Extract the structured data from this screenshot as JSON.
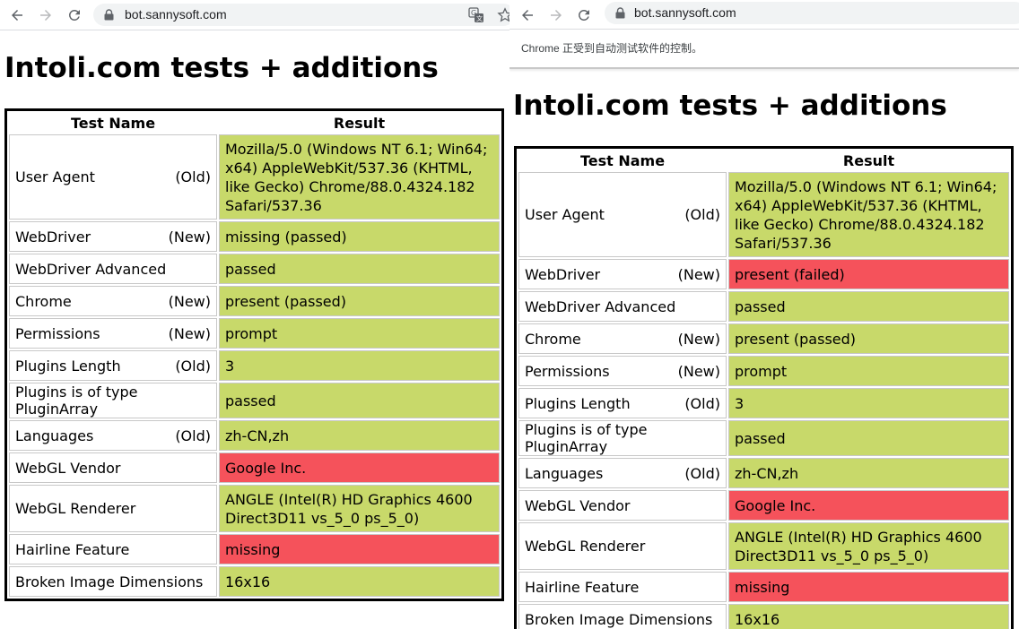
{
  "left": {
    "url": "bot.sannysoft.com",
    "heading": "Intoli.com tests + additions",
    "table": {
      "headers": [
        "Test Name",
        "Result"
      ],
      "rows": [
        {
          "name": "User Agent",
          "tag": "(Old)",
          "result": "Mozilla/5.0 (Windows NT 6.1; Win64; x64) AppleWebKit/537.36 (KHTML, like Gecko) Chrome/88.0.4324.182 Safari/537.36",
          "status": "passed"
        },
        {
          "name": "WebDriver",
          "tag": "(New)",
          "result": "missing (passed)",
          "status": "passed"
        },
        {
          "name": "WebDriver Advanced",
          "tag": "",
          "result": "passed",
          "status": "passed"
        },
        {
          "name": "Chrome",
          "tag": "(New)",
          "result": "present (passed)",
          "status": "passed"
        },
        {
          "name": "Permissions",
          "tag": "(New)",
          "result": "prompt",
          "status": "passed"
        },
        {
          "name": "Plugins Length",
          "tag": "(Old)",
          "result": "3",
          "status": "passed"
        },
        {
          "name": "Plugins is of type PluginArray",
          "tag": "",
          "result": "passed",
          "status": "passed"
        },
        {
          "name": "Languages",
          "tag": "(Old)",
          "result": "zh-CN,zh",
          "status": "passed"
        },
        {
          "name": "WebGL Vendor",
          "tag": "",
          "result": "Google Inc.",
          "status": "failed"
        },
        {
          "name": "WebGL Renderer",
          "tag": "",
          "result": "ANGLE (Intel(R) HD Graphics 4600 Direct3D11 vs_5_0 ps_5_0)",
          "status": "passed"
        },
        {
          "name": "Hairline Feature",
          "tag": "",
          "result": "missing",
          "status": "failed"
        },
        {
          "name": "Broken Image Dimensions",
          "tag": "",
          "result": "16x16",
          "status": "passed"
        }
      ]
    }
  },
  "right": {
    "url": "bot.sannysoft.com",
    "infobar": "Chrome 正受到自动测试软件的控制。",
    "heading": "Intoli.com tests + additions",
    "table": {
      "headers": [
        "Test Name",
        "Result"
      ],
      "rows": [
        {
          "name": "User Agent",
          "tag": "(Old)",
          "result": "Mozilla/5.0 (Windows NT 6.1; Win64; x64) AppleWebKit/537.36 (KHTML, like Gecko) Chrome/88.0.4324.182 Safari/537.36",
          "status": "passed"
        },
        {
          "name": "WebDriver",
          "tag": "(New)",
          "result": "present (failed)",
          "status": "failed"
        },
        {
          "name": "WebDriver Advanced",
          "tag": "",
          "result": "passed",
          "status": "passed"
        },
        {
          "name": "Chrome",
          "tag": "(New)",
          "result": "present (passed)",
          "status": "passed"
        },
        {
          "name": "Permissions",
          "tag": "(New)",
          "result": "prompt",
          "status": "passed"
        },
        {
          "name": "Plugins Length",
          "tag": "(Old)",
          "result": "3",
          "status": "passed"
        },
        {
          "name": "Plugins is of type PluginArray",
          "tag": "",
          "result": "passed",
          "status": "passed"
        },
        {
          "name": "Languages",
          "tag": "(Old)",
          "result": "zh-CN,zh",
          "status": "passed"
        },
        {
          "name": "WebGL Vendor",
          "tag": "",
          "result": "Google Inc.",
          "status": "failed"
        },
        {
          "name": "WebGL Renderer",
          "tag": "",
          "result": "ANGLE (Intel(R) HD Graphics 4600 Direct3D11 vs_5_0 ps_5_0)",
          "status": "passed"
        },
        {
          "name": "Hairline Feature",
          "tag": "",
          "result": "missing",
          "status": "failed"
        },
        {
          "name": "Broken Image Dimensions",
          "tag": "",
          "result": "16x16",
          "status": "passed"
        }
      ]
    }
  },
  "icons": {
    "back": "arrow-left-icon",
    "forward": "arrow-right-icon",
    "reload": "reload-icon",
    "lock": "lock-icon",
    "translate": "translate-icon",
    "bookmark": "star-icon"
  },
  "colors": {
    "passed": "#c8d96a",
    "failed": "#f5525b"
  }
}
